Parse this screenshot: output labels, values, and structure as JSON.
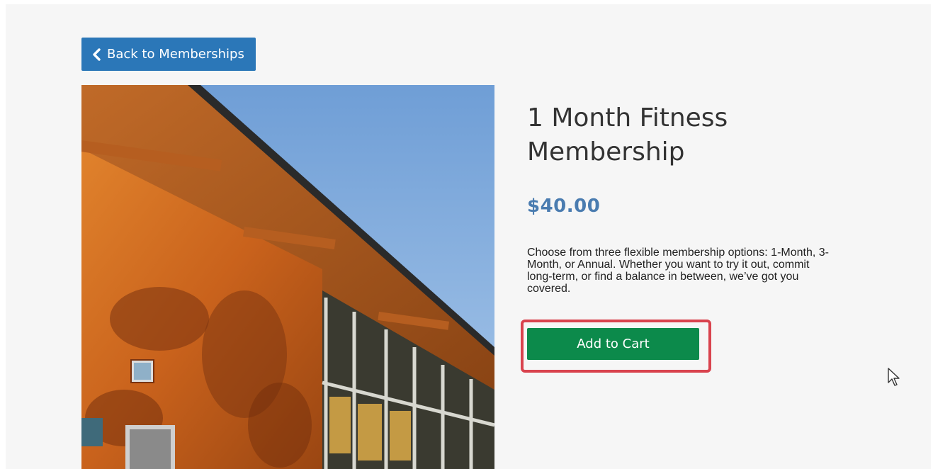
{
  "navigation": {
    "back_label": "Back to Memberships"
  },
  "product": {
    "title": "1 Month Fitness Membership",
    "price": "$40.00",
    "description": "Choose from three flexible membership options: 1-Month, 3-Month, or Annual. Whether you want to try it out, commit long-term, or find a balance in between, we’ve got you covered.",
    "add_to_cart_label": "Add to Cart"
  },
  "colors": {
    "back_button": "#2b77b8",
    "price": "#4a7cb0",
    "add_to_cart": "#0c8a4b",
    "highlight": "#d9434e"
  },
  "icons": {
    "back": "chevron-left-icon",
    "cursor": "mouse-pointer-icon"
  }
}
